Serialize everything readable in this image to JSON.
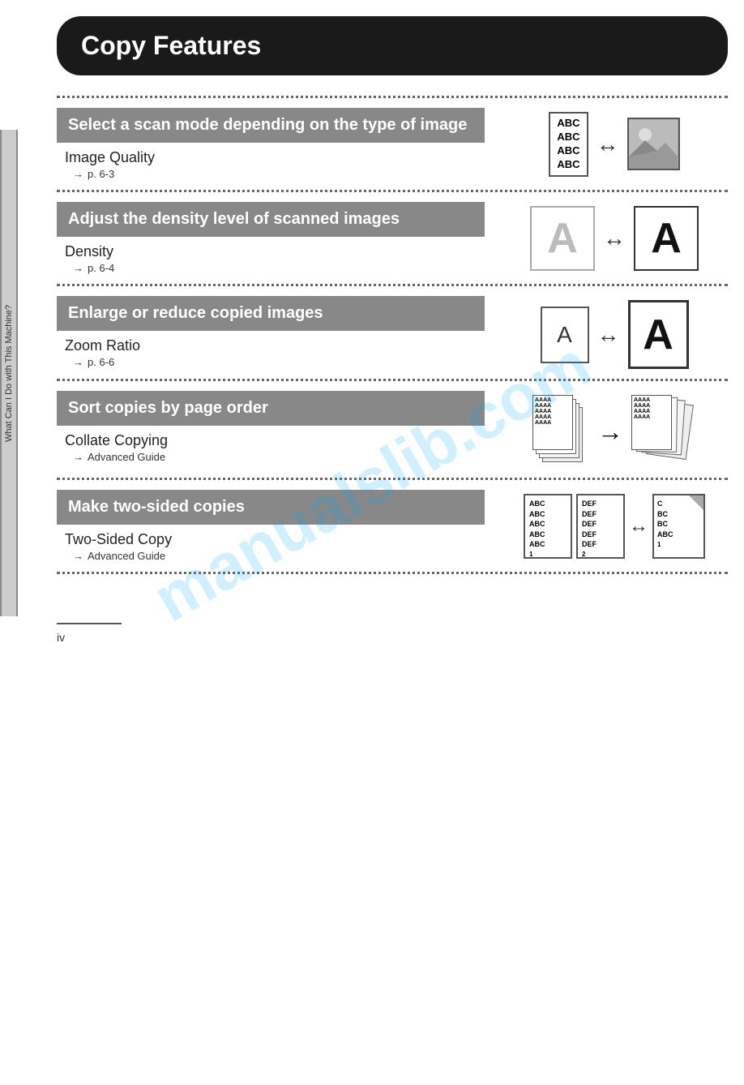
{
  "title": "Copy Features",
  "side_label": "What Can I Do with This Machine?",
  "sections": [
    {
      "id": "image-quality",
      "header": "Select a scan mode depending on the type of image",
      "feature_name": "Image Quality",
      "ref": "p. 6-3",
      "ref_prefix": "→"
    },
    {
      "id": "density",
      "header": "Adjust the density level of scanned images",
      "feature_name": "Density",
      "ref": "p. 6-4",
      "ref_prefix": "→"
    },
    {
      "id": "zoom",
      "header": "Enlarge or reduce copied images",
      "feature_name": "Zoom Ratio",
      "ref": "p. 6-6",
      "ref_prefix": "→"
    },
    {
      "id": "collate",
      "header": "Sort copies by page order",
      "feature_name": "Collate Copying",
      "ref": "Advanced Guide",
      "ref_prefix": "→"
    },
    {
      "id": "twosided",
      "header": "Make two-sided copies",
      "feature_name": "Two-Sided Copy",
      "ref": "Advanced Guide",
      "ref_prefix": "→"
    }
  ],
  "footer": {
    "page": "iv"
  },
  "watermark": "manualslib.com"
}
